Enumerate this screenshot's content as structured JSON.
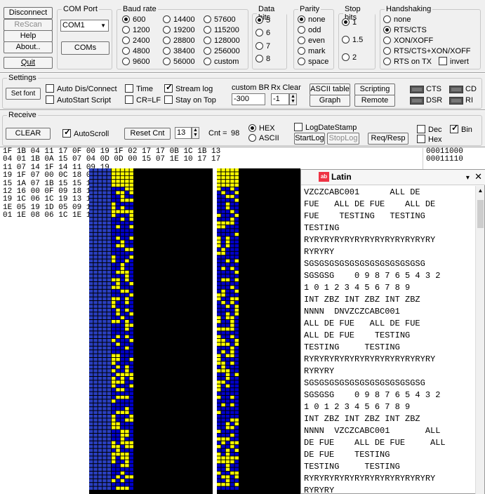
{
  "buttons": {
    "disconnect": "Disconnect",
    "rescan": "ReScan",
    "help": "Help",
    "about": "About..",
    "quit": "Quit",
    "coms": "COMs",
    "set_font": "Set font",
    "ascii_table": "ASCII table",
    "scripting": "Scripting",
    "graph": "Graph",
    "remote": "Remote",
    "clear": "CLEAR",
    "reset_cnt": "Reset Cnt",
    "startlog": "StartLog",
    "stoplog": "StopLog",
    "req_resp": "Req/Resp"
  },
  "com_port": {
    "legend": "COM Port",
    "value": "COM1"
  },
  "baud_rate": {
    "legend": "Baud rate",
    "options": [
      "600",
      "1200",
      "2400",
      "4800",
      "9600",
      "14400",
      "19200",
      "28800",
      "38400",
      "56000",
      "57600",
      "115200",
      "128000",
      "256000",
      "custom"
    ],
    "selected": "600"
  },
  "data_bits": {
    "legend": "Data bits",
    "options": [
      "5",
      "6",
      "7",
      "8"
    ],
    "selected": "5"
  },
  "parity": {
    "legend": "Parity",
    "options": [
      "none",
      "odd",
      "even",
      "mark",
      "space"
    ],
    "selected": "none"
  },
  "stop_bits": {
    "legend": "Stop bits",
    "options": [
      "1",
      "1.5",
      "2"
    ],
    "selected": "1"
  },
  "handshaking": {
    "legend": "Handshaking",
    "options": [
      "none",
      "RTS/CTS",
      "XON/XOFF",
      "RTS/CTS+XON/XOFF",
      "RTS on TX"
    ],
    "selected": "RTS/CTS",
    "invert_label": "invert"
  },
  "settings": {
    "legend": "Settings",
    "auto_dis_connect": "Auto Dis/Connect",
    "autostart_script": "AutoStart Script",
    "time": "Time",
    "cr_lf": "CR=LF",
    "stream_log": "Stream log",
    "stay_on_top": "Stay on Top",
    "custom_br_label": "custom BR",
    "custom_br_value": "-300",
    "rx_clear_label": "Rx Clear",
    "rx_clear_value": "-1",
    "cts": "CTS",
    "cd": "CD",
    "dsr": "DSR",
    "ri": "RI"
  },
  "receive": {
    "legend": "Receive",
    "autoscroll": "AutoScroll",
    "count_value": "13",
    "cnt_label": "Cnt =",
    "cnt_value": "98",
    "hex": "HEX",
    "ascii": "ASCII",
    "logdatestamp": "LogDateStamp",
    "dec": "Dec",
    "hex_chk": "Hex",
    "bin": "Bin"
  },
  "hex_lines": [
    "1F 1B 04 11 17 0F 00 19 1F 02 17 17 0B 1C 1B 13",
    "04 01 1B 0A 15 07 04 0D 0D 00 15 07 1E 10 17 17",
    "11 07 14 1F 14 11 09 19",
    "19 1F 07 00 0C 18 09 00",
    "15 1A 07 1B 15 15 1A 0F",
    "12 16 00 0F 09 18 14 09",
    "19 1C 06 1C 19 13 13 01",
    "1E 05 19 1D 05 09 15 07",
    "01 1E 08 06 1C 1E 19 1D"
  ],
  "bin_lines": [
    "00011000",
    "00011110"
  ],
  "latin": {
    "title": "Latin",
    "lines": [
      "VZCZCABC001      ALL DE",
      "FUE   ALL DE FUE    ALL DE",
      "FUE    TESTING   TESTING",
      "TESTING",
      "RYRYRYRYRYRYRYRYRYRYRYRYRY",
      "RYRYRY",
      "SGSGSGSGSGSGSGSGSGSGSGSG",
      "SGSGSG    0 9 8 7 6 5 4 3 2",
      "1 0 1 2 3 4 5 6 7 8 9",
      "INT ZBZ INT ZBZ INT ZBZ",
      "NNNN  DNVZCZCABC001",
      "ALL DE FUE   ALL DE FUE",
      "ALL DE FUE    TESTING",
      "TESTING     TESTING",
      "RYRYRYRYRYRYRYRYRYRYRYRYRY",
      "RYRYRY",
      "SGSGSGSGSGSGSGSGSGSGSGSG",
      "SGSGSG    0 9 8 7 6 5 4 3 2",
      "1 0 1 2 3 4 5 6 7 8 9",
      "INT ZBZ INT ZBZ INT ZBZ",
      "NNNN  VZCZCABC001       ALL",
      "DE FUE    ALL DE FUE     ALL",
      "DE FUE    TESTING",
      "TESTING     TESTING",
      "RYRYRYRYRYRYRYRYRYRYRYRYRY",
      "RYRYRY"
    ]
  },
  "colors": {
    "bit_on": "#ffff00",
    "bit_off": "#0000cc",
    "grid_line": "#000080",
    "window_bg": "#f0f0f0"
  }
}
